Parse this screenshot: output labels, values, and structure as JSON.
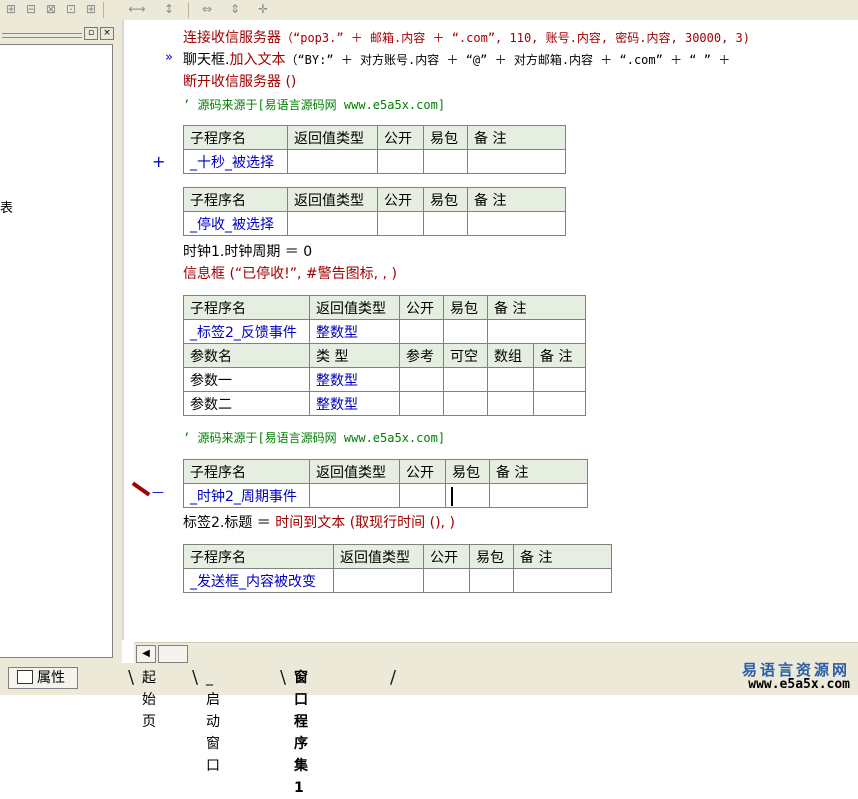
{
  "code_lines": {
    "l1_fn": "连接收信服务器",
    "l1_args": "（“pop3.” ＋ 邮箱.内容 ＋ “.com”, 110, 账号.内容, 密码.内容, 30000, 3)",
    "l2_marker": "»",
    "l2_obj": "聊天框.",
    "l2_fn": "加入文本",
    "l2_args": "（“BY:” ＋ 对方账号.内容 ＋ “@” ＋ 对方邮箱.内容 ＋ “.com” ＋ “ ” ＋",
    "l3": "断开收信服务器 ()",
    "comment1": "’ 源码来源于[易语言源码网 www.e5a5x.com]",
    "clock_line": "时钟1.时钟周期 ＝ 0",
    "msgbox_line": "信息框 (“已停收!”, #警告图标, , )",
    "comment2": "’ 源码来源于[易语言源码网 www.e5a5x.com]",
    "label_line_a": "标签2.标题 ＝ ",
    "label_line_b": "时间到文本 (取现行时间 (), )"
  },
  "headers": {
    "sub": [
      "子程序名",
      "返回值类型",
      "公开",
      "易包",
      "备 注"
    ],
    "param": [
      "参数名",
      "类 型",
      "参考",
      "可空",
      "数组",
      "备 注"
    ]
  },
  "subs": {
    "s1": {
      "name": "_十秒_被选择",
      "marker": "+"
    },
    "s2": {
      "name": "_停收_被选择"
    },
    "s3": {
      "name": "_标签2_反馈事件",
      "ret": "整数型",
      "params": [
        {
          "name": "参数一",
          "type": "整数型"
        },
        {
          "name": "参数二",
          "type": "整数型"
        }
      ]
    },
    "s4": {
      "name": "_时钟2_周期事件",
      "marker": "—"
    },
    "s5": {
      "name": "_发送框_内容被改变"
    }
  },
  "left_panel": {
    "close_icon": "×",
    "restore_icon": "▫",
    "partial_text": "表"
  },
  "bottom": {
    "properties_label": "属性",
    "tabs": [
      "起始页",
      "_启动窗口",
      "窗口程序集1"
    ],
    "brand_cn": "易语言资源网",
    "brand_url": "www.e5a5x.com"
  }
}
